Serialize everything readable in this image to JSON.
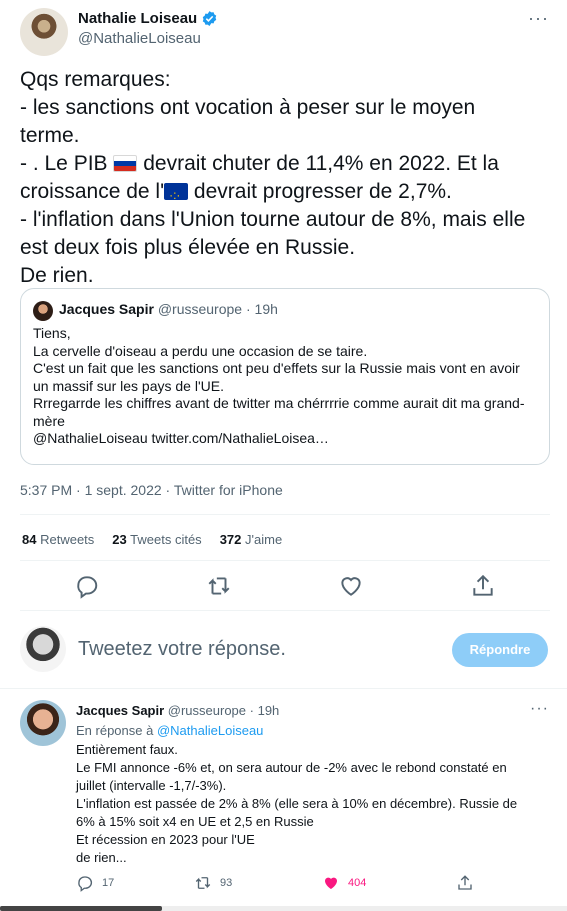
{
  "main_tweet": {
    "author_name": "Nathalie Loiseau",
    "author_handle": "@NathalieLoiseau",
    "body_lines": [
      "Qqs remarques:",
      "- les sanctions ont vocation à peser sur le moyen",
      "terme.",
      "- . Le PIB",
      " devrait chuter de 11,4% en 2022. Et la",
      "croissance de l'",
      " devrait progresser de 2,7%.",
      "- l'inflation dans l'Union tourne autour de 8%, mais elle",
      "est deux fois plus élevée en Russie.",
      "De rien."
    ],
    "timestamp": "5:37 PM · 1 sept. 2022 · Twitter for iPhone",
    "stats": {
      "retweets_count": "84",
      "retweets_label": "Retweets",
      "quotes_count": "23",
      "quotes_label": "Tweets cités",
      "likes_count": "372",
      "likes_label": "J'aime"
    }
  },
  "quoted_tweet": {
    "author_name": "Jacques Sapir",
    "author_handle": "@russeurope",
    "time": "· 19h",
    "lines": [
      "Tiens,",
      "La cervelle d'oiseau a perdu une occasion de se taire.",
      "C'est un fait que les sanctions ont peu d'effets sur la Russie mais vont en avoir",
      "un massif sur les pays de l'UE.",
      "Rrregarrde les chiffres avant de twitter ma chérrrrie comme aurait dit ma grand-",
      "mère",
      "@NathalieLoiseau twitter.com/NathalieLoisea…"
    ]
  },
  "reply_box": {
    "placeholder": "Tweetez votre réponse.",
    "button_label": "Répondre"
  },
  "reply_tweet": {
    "author_name": "Jacques Sapir",
    "author_handle": "@russeurope",
    "time": "· 19h",
    "reply_prefix": "En réponse à",
    "reply_to": "@NathalieLoiseau",
    "lines": [
      "Entièrement faux.",
      "Le FMI annonce -6% et, on sera autour de -2% avec le rebond constaté en",
      "juillet (intervalle -1,7/-3%).",
      "L'inflation est passée de 2% à 8% (elle sera à 10% en décembre). Russie de",
      "6% à 15% soit x4 en UE et 2,5 en Russie",
      "Et récession en 2023 pour l'UE",
      "de rien..."
    ],
    "replies": "17",
    "retweets": "93",
    "likes": "404"
  },
  "icons": {
    "verified": "verified-badge-icon",
    "reply": "reply-icon",
    "retweet": "retweet-icon",
    "like": "heart-icon",
    "share": "share-icon"
  },
  "colors": {
    "accent": "#1d9bf0",
    "like": "#f91880",
    "muted": "#536471",
    "button_disabled": "#8ecdf8"
  }
}
